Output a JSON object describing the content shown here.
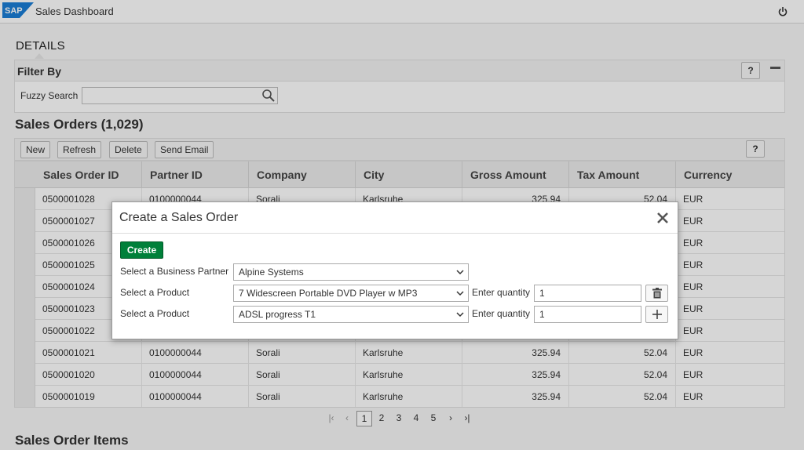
{
  "shell": {
    "logo_text": "SAP",
    "app_title": "Sales Dashboard",
    "power_icon": "power-icon"
  },
  "details": {
    "title": "DETAILS"
  },
  "filter": {
    "title": "Filter By",
    "help_label": "?",
    "fuzzy_label": "Fuzzy Search",
    "fuzzy_value": ""
  },
  "orders": {
    "title": "Sales Orders (1,029)",
    "toolbar": {
      "new_label": "New",
      "refresh_label": "Refresh",
      "delete_label": "Delete",
      "email_label": "Send Email",
      "help_label": "?"
    },
    "columns": [
      "Sales Order ID",
      "Partner ID",
      "Company",
      "City",
      "Gross Amount",
      "Tax Amount",
      "Currency"
    ],
    "rows": [
      [
        "0500001028",
        "0100000044",
        "Sorali",
        "Karlsruhe",
        "325.94",
        "52.04",
        "EUR"
      ],
      [
        "0500001027",
        "",
        "",
        "",
        "",
        "",
        "EUR"
      ],
      [
        "0500001026",
        "",
        "",
        "",
        "",
        "",
        "EUR"
      ],
      [
        "0500001025",
        "",
        "",
        "",
        "",
        "",
        "EUR"
      ],
      [
        "0500001024",
        "",
        "",
        "",
        "",
        "",
        "EUR"
      ],
      [
        "0500001023",
        "",
        "",
        "",
        "",
        "",
        "EUR"
      ],
      [
        "0500001022",
        "",
        "",
        "",
        "",
        "",
        "EUR"
      ],
      [
        "0500001021",
        "0100000044",
        "Sorali",
        "Karlsruhe",
        "325.94",
        "52.04",
        "EUR"
      ],
      [
        "0500001020",
        "0100000044",
        "Sorali",
        "Karlsruhe",
        "325.94",
        "52.04",
        "EUR"
      ],
      [
        "0500001019",
        "0100000044",
        "Sorali",
        "Karlsruhe",
        "325.94",
        "52.04",
        "EUR"
      ]
    ],
    "pager": {
      "first": "|‹",
      "prev": "‹",
      "pages": [
        "1",
        "2",
        "3",
        "4",
        "5"
      ],
      "current": "1",
      "next": "›",
      "last": "›|"
    }
  },
  "items": {
    "title": "Sales Order Items"
  },
  "dialog": {
    "title": "Create a Sales Order",
    "create_label": "Create",
    "partner_label": "Select a Business Partner",
    "partner_value": "Alpine Systems",
    "product_label": "Select a Product",
    "quantity_label": "Enter quantity",
    "products": [
      {
        "value": "7 Widescreen Portable DVD Player w MP3",
        "quantity": "1",
        "action_icon": "trash-icon"
      },
      {
        "value": "ADSL progress T1",
        "quantity": "1",
        "action_icon": "plus-icon"
      }
    ]
  },
  "colors": {
    "create_button": "#00803a",
    "overlay": "rgba(0,0,0,0.16)",
    "sap_blue": "#0a6ed1"
  }
}
